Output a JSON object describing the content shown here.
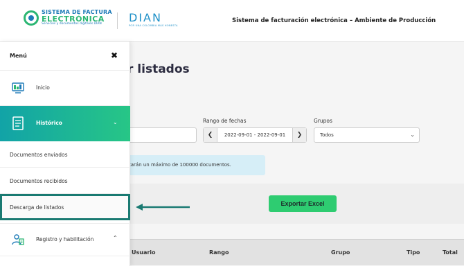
{
  "header": {
    "logo_line1": "SISTEMA DE FACTURA",
    "logo_line2": "ELECTRÓNICA",
    "logo_line3": "Servicios y documentos digitales DIAN",
    "dian_word": "DIAN",
    "dian_sub": "POR UNA COLOMBIA MÁS HONESTA",
    "title": "Sistema de facturación electrónica – Ambiente de Producción"
  },
  "sidebar": {
    "menu_label": "Menú",
    "close_glyph": "✖",
    "items": {
      "inicio": "Inicio",
      "historico": "Histórico",
      "enviados": "Documentos enviados",
      "recibidos": "Documentos recibidos",
      "descarga": "Descarga de listados",
      "registro": "Registro y habilitación"
    }
  },
  "main": {
    "title": "r listados",
    "range_label": "Rango de fechas",
    "range_value": "2022-09-01 - 2022-09-01",
    "groups_label": "Grupos",
    "groups_value": "Todos",
    "info_text": "tarán un máximo de 100000 documentos.",
    "export_label": "Exportar Excel",
    "columns": [
      "Usuario",
      "Rango",
      "Grupo",
      "Tipo",
      "Total"
    ]
  },
  "colors": {
    "accent": "#27c686",
    "highlight_border": "#1a7a72",
    "export_button": "#2ecc71"
  }
}
